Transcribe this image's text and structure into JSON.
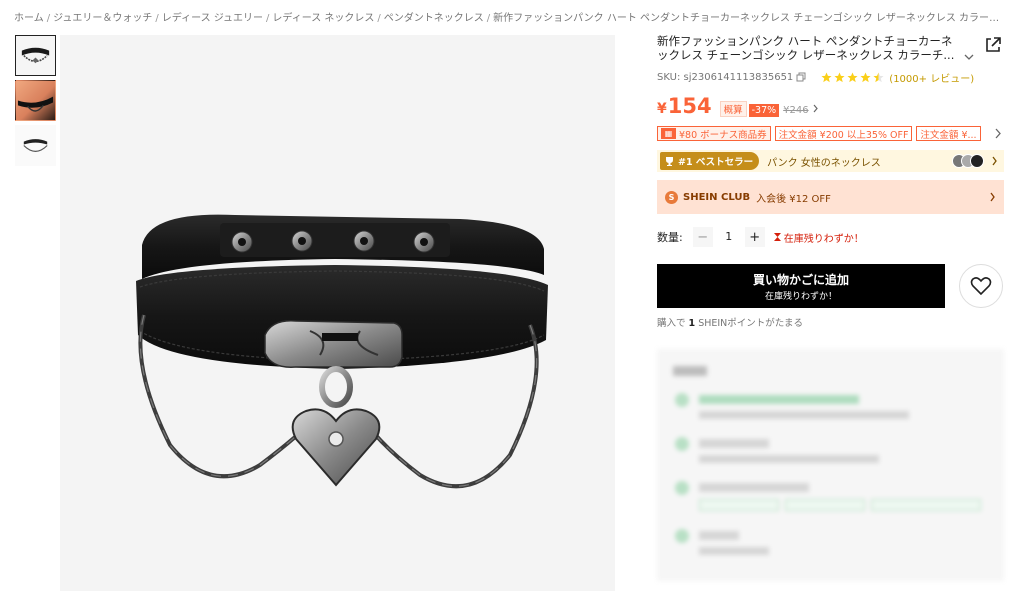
{
  "breadcrumb": [
    "ホーム",
    "ジュエリー＆ウォッチ",
    "レディース ジュエリー",
    "レディース ネックレス",
    "ペンダントネックレス",
    "新作ファッションパンク ハート ペンダントチョーカーネックレス チェーンゴシック レザーネックレス カラーチ..."
  ],
  "product": {
    "title": "新作ファッションパンク ハート ペンダントチョーカーネックレス チェーンゴシック レザーネックレス カラーチ...",
    "sku": "SKU: sj2306141113835651",
    "rating": 4.5,
    "reviews": "(1000+ レビュー)",
    "price_symbol": "¥",
    "price": "154",
    "approx_label": "概算",
    "discount": "-37%",
    "original_price": "¥246"
  },
  "promos": [
    {
      "icon": "gift-icon",
      "text": "¥80 ボーナス商品券"
    },
    {
      "text": "注文金額 ¥200 以上35% OFF"
    },
    {
      "text": "注文金額 ¥..."
    }
  ],
  "bestseller": {
    "badge": "#1 ベストセラー",
    "text": "パンク 女性のネックレス"
  },
  "club": {
    "icon_letter": "S",
    "label": "SHEIN CLUB",
    "text": "入会後 ¥12 OFF"
  },
  "quantity": {
    "label": "数量:",
    "value": "1",
    "minus": "−",
    "plus": "+",
    "stock_warning": "在庫残りわずか！"
  },
  "cart": {
    "main_label": "買い物かごに追加",
    "sub_label": "在庫残りわずか！"
  },
  "points": {
    "prefix": "購入で",
    "count": "1",
    "suffix": "SHEINポイントがたまる"
  },
  "colors": {
    "price": "#fa6338",
    "cart_button": "#000000",
    "bestseller_badge": "#c58e1a",
    "club_background": "#ffe2d3"
  }
}
